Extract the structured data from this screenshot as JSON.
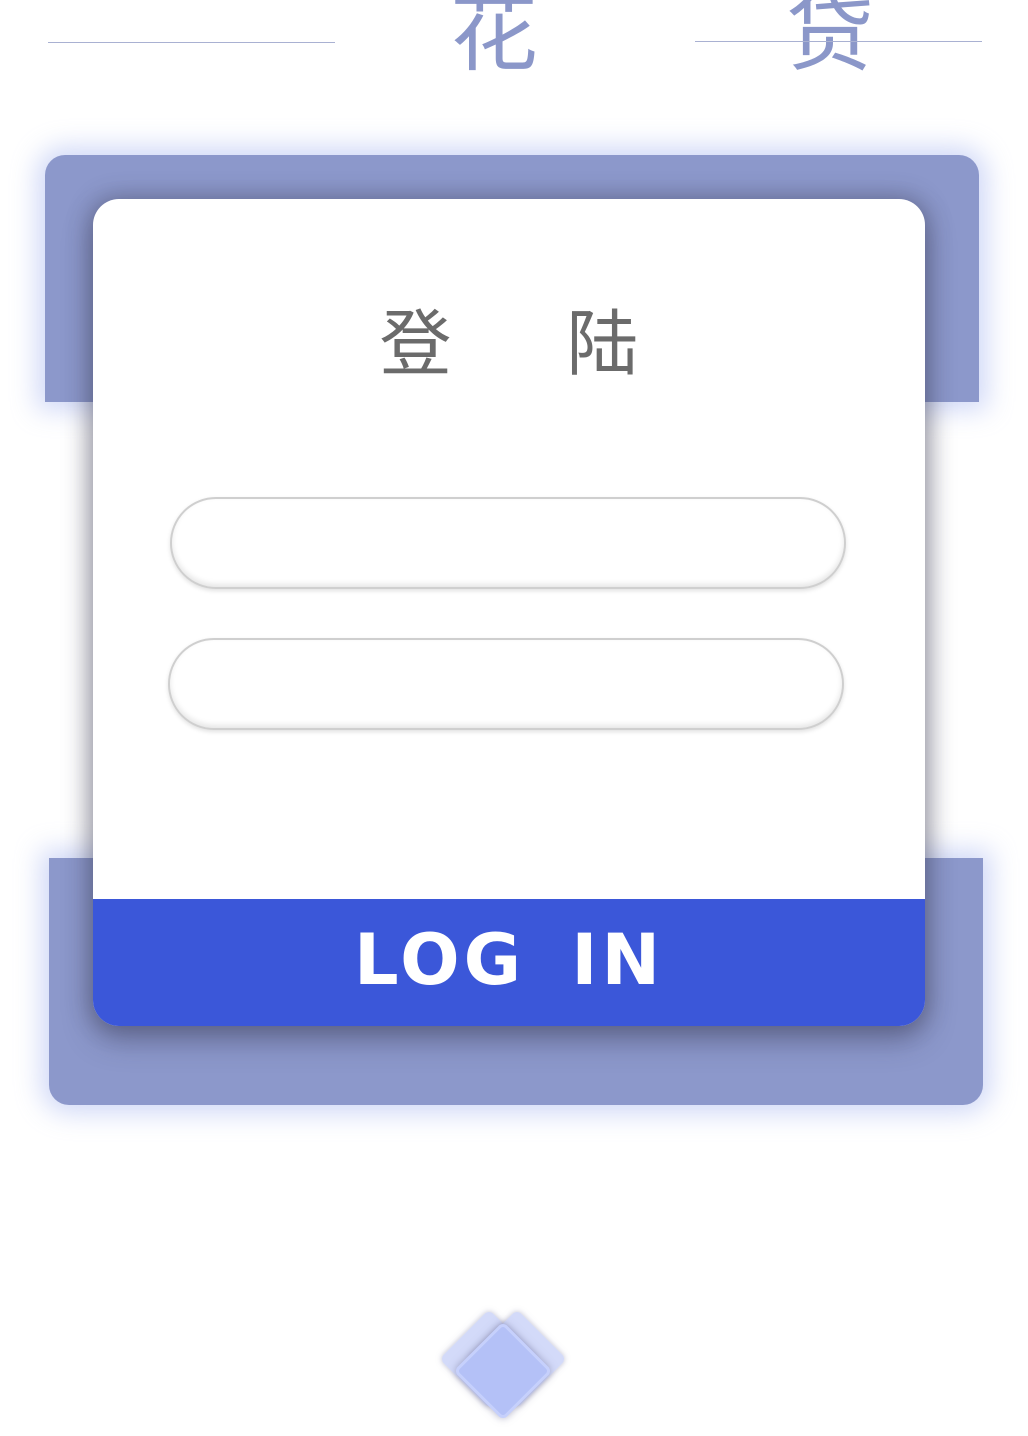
{
  "header": {
    "brand_title": "花 贷"
  },
  "login_card": {
    "title": "登 陆",
    "username_field": {
      "value": "",
      "placeholder": ""
    },
    "password_field": {
      "value": "",
      "placeholder": ""
    },
    "login_button_label": "LOG IN"
  },
  "colors": {
    "brand_text": "#8b97c9",
    "panel": "#8c98cb",
    "button": "#3b57d9",
    "title_text": "#6b6b6b"
  },
  "decoration": {
    "bottom_icon": "diamond-logo-icon"
  }
}
